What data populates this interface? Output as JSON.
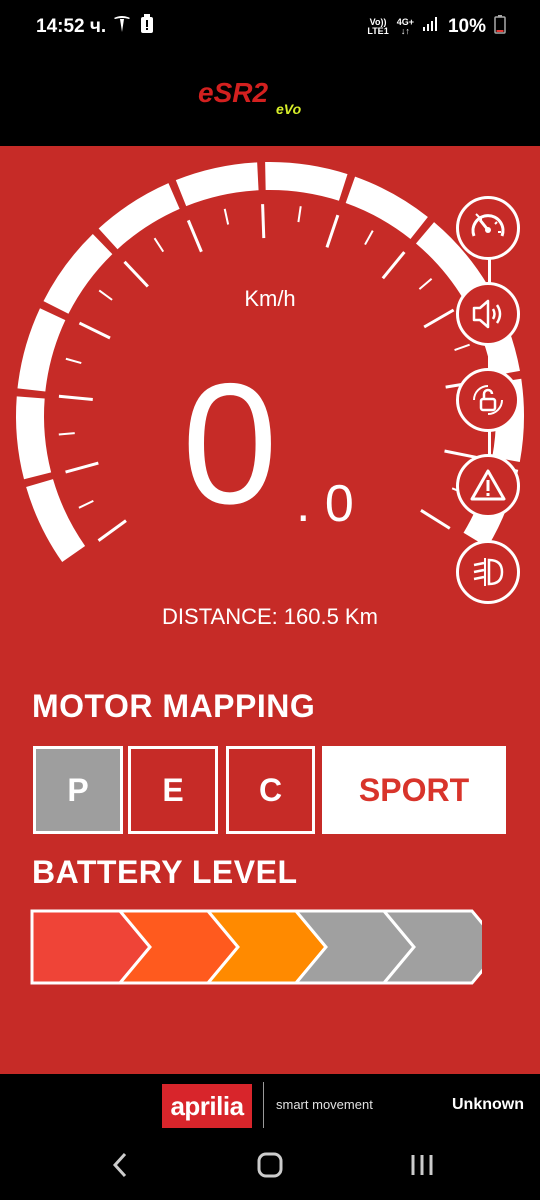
{
  "status_bar": {
    "time": "14:52 ч.",
    "network_top": "Vo))",
    "network_bottom": "LTE1",
    "network_gen": "4G+",
    "battery_percent": "10%",
    "icons": [
      "tesla-icon",
      "battery-alert-icon",
      "signal-icon",
      "battery-icon"
    ]
  },
  "header": {
    "logo_text": "eSR2",
    "logo_sub": "eVo"
  },
  "speedometer": {
    "unit": "Km/h",
    "speed_integer": "0",
    "speed_decimal": ". 0",
    "distance_label": "DISTANCE:",
    "distance_value": "160.5 Km"
  },
  "side_controls": [
    {
      "name": "cruise-control",
      "icon": "speedometer-icon"
    },
    {
      "name": "horn",
      "icon": "speaker-icon"
    },
    {
      "name": "lock",
      "icon": "unlock-icon"
    },
    {
      "name": "hazard",
      "icon": "warning-icon"
    },
    {
      "name": "lights",
      "icon": "headlight-icon"
    }
  ],
  "motor_mapping": {
    "title": "MOTOR MAPPING",
    "modes": [
      "P",
      "E",
      "C",
      "SPORT"
    ],
    "selected": "SPORT"
  },
  "battery": {
    "title": "BATTERY LEVEL",
    "segments_total": 5,
    "segments_filled": 3,
    "colors": [
      "#ef4437",
      "#ff5a1e",
      "#ff8a00",
      "#a0a0a0",
      "#a0a0a0"
    ]
  },
  "footer": {
    "brand": "aprilia",
    "tagline": "smart movement",
    "status": "Unknown"
  },
  "colors": {
    "background": "#c62b27",
    "accent_sport_text": "#d8342b",
    "selected_mode_bg": "#9e9e9e"
  }
}
